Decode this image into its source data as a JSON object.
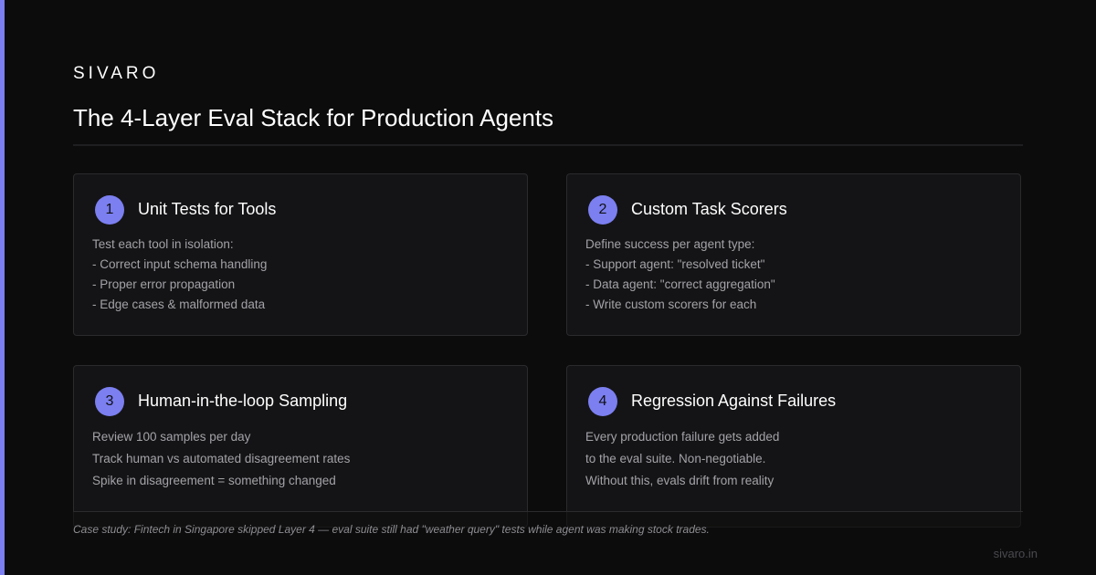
{
  "brand": "SIVARO",
  "title": "The 4-Layer Eval Stack for Production Agents",
  "cards": [
    {
      "number": "1",
      "title": "Unit Tests for Tools",
      "lines": [
        "Test each tool in isolation:",
        "- Correct input schema handling",
        "- Proper error propagation",
        "- Edge cases & malformed data"
      ]
    },
    {
      "number": "2",
      "title": "Custom Task Scorers",
      "lines": [
        "Define success per agent type:",
        "- Support agent: \"resolved ticket\"",
        "- Data agent: \"correct aggregation\"",
        "- Write custom scorers for each"
      ]
    },
    {
      "number": "3",
      "title": "Human-in-the-loop Sampling",
      "lines": [
        "Review 100 samples per day",
        "Track human vs automated disagreement rates",
        "Spike in disagreement = something changed"
      ]
    },
    {
      "number": "4",
      "title": "Regression Against Failures",
      "lines": [
        "Every production failure gets added",
        "to the eval suite. Non-negotiable.",
        "Without this, evals drift from reality"
      ]
    }
  ],
  "case_study": "Case study: Fintech in Singapore skipped Layer 4 — eval suite still had \"weather query\" tests while agent was making stock trades.",
  "footer_url": "sivaro.in",
  "colors": {
    "accent": "#7b7ff0",
    "background": "#0c0c0d",
    "card_background": "#141416",
    "card_border": "#2b2b2e",
    "body_text": "#a3a3a8"
  }
}
